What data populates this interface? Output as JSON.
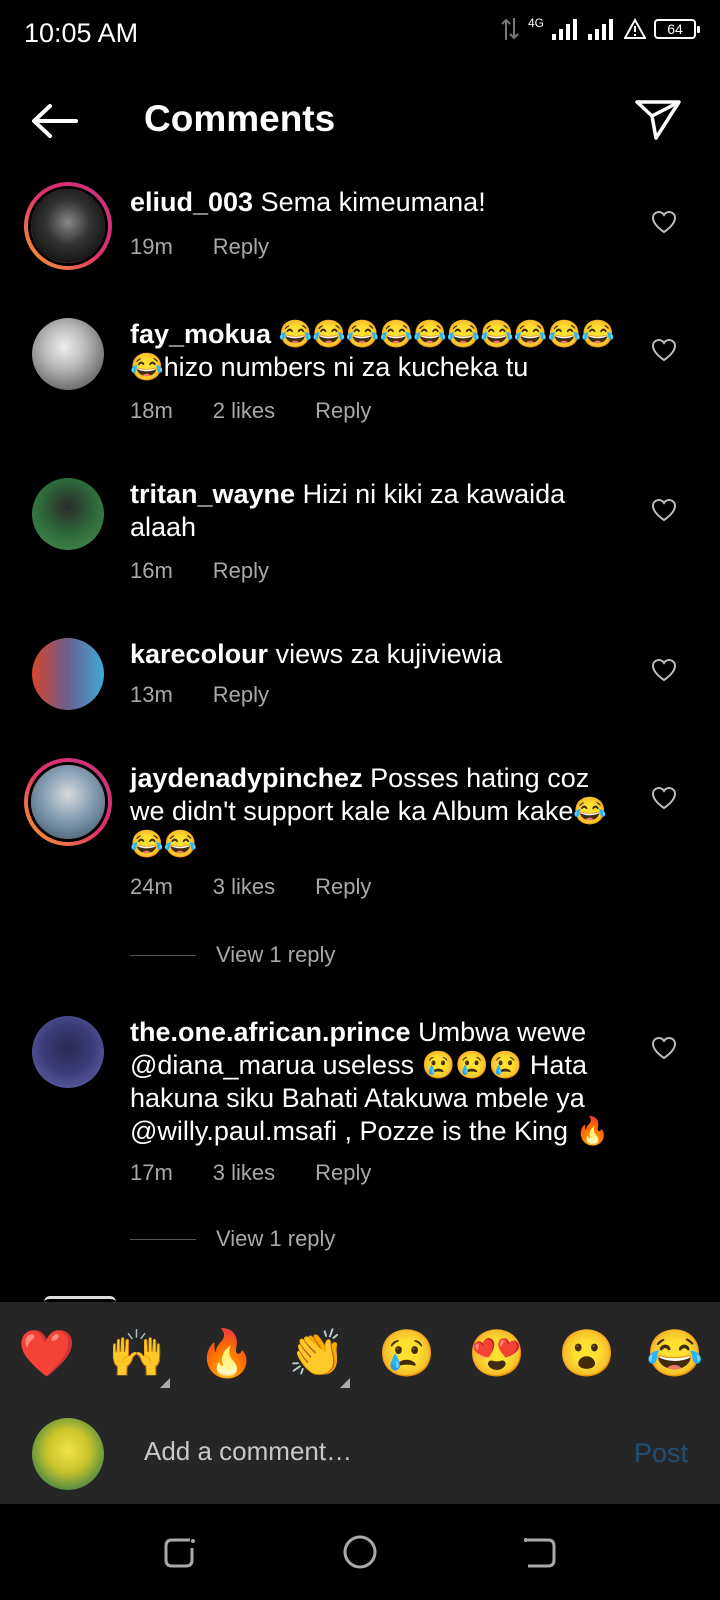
{
  "status": {
    "time": "10:05 AM",
    "network": "4G",
    "battery": "64"
  },
  "header": {
    "title": "Comments"
  },
  "comments": [
    {
      "user": "eliud_003",
      "text": "Sema kimeumana!",
      "time": "19m",
      "likes": "",
      "reply": "Reply"
    },
    {
      "user": "fay_mokua",
      "text": "😂😂😂😂😂😂😂😂😂😂😂hizo numbers ni za kucheka tu",
      "time": "18m",
      "likes": "2 likes",
      "reply": "Reply"
    },
    {
      "user": "tritan_wayne",
      "text": "Hizi ni kiki za kawaida alaah",
      "time": "16m",
      "likes": "",
      "reply": "Reply"
    },
    {
      "user": "karecolour",
      "text": "views za kujiviewia",
      "time": "13m",
      "likes": "",
      "reply": "Reply"
    },
    {
      "user": "jaydenadypinchez",
      "text": "Posses hating coz we didn't support kale ka Album kake😂😂😂",
      "time": "24m",
      "likes": "3 likes",
      "reply": "Reply",
      "view_replies": "View 1 reply"
    },
    {
      "user": "the.one.african.prince",
      "text": "Umbwa wewe @diana_marua  useless 😢😢😢 Hata hakuna siku Bahati Atakuwa mbele ya @willy.paul.msafi , Pozze is the King 🔥",
      "time": "17m",
      "likes": "3 likes",
      "reply": "Reply",
      "view_replies": "View 1 reply"
    }
  ],
  "emoji_bar": [
    "❤️",
    "🙌",
    "🔥",
    "👏",
    "😢",
    "😍",
    "😮",
    "😂"
  ],
  "composer": {
    "placeholder": "Add a comment…",
    "post_label": "Post"
  },
  "colors": {
    "background": "#000000",
    "bar": "#262626",
    "muted": "#a8a8a8",
    "post": "#1d4f73"
  },
  "icons": [
    "back-arrow-icon",
    "send-icon",
    "heart-icon",
    "recent-apps-icon",
    "home-icon",
    "back-nav-icon"
  ]
}
